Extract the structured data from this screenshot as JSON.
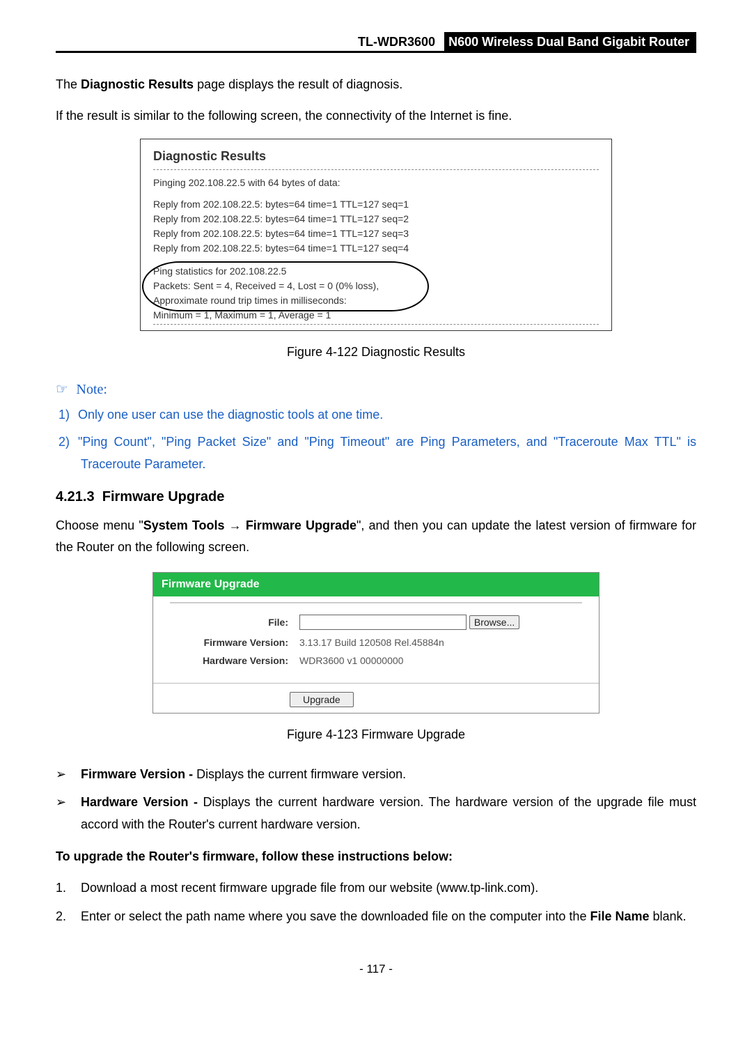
{
  "header": {
    "model": "TL-WDR3600",
    "device": "N600 Wireless Dual Band Gigabit Router"
  },
  "intro": {
    "p1a": "The ",
    "p1b": "Diagnostic Results",
    "p1c": " page displays the result of diagnosis.",
    "p2": "If the result is similar to the following screen, the connectivity of the Internet is fine."
  },
  "diag": {
    "title": "Diagnostic Results",
    "line0": "Pinging 202.108.22.5 with 64 bytes of data:",
    "lines": [
      "Reply from 202.108.22.5:  bytes=64  time=1  TTL=127  seq=1",
      "Reply from 202.108.22.5:  bytes=64  time=1  TTL=127  seq=2",
      "Reply from 202.108.22.5:  bytes=64  time=1  TTL=127  seq=3",
      "Reply from 202.108.22.5:  bytes=64  time=1  TTL=127  seq=4"
    ],
    "stats": [
      "Ping statistics for 202.108.22.5",
      "  Packets: Sent = 4, Received = 4, Lost = 0 (0% loss),",
      "Approximate round trip times in milliseconds:",
      "  Minimum = 1, Maximum = 1, Average = 1"
    ]
  },
  "fig1": "Figure 4-122 Diagnostic Results",
  "note": {
    "icon": "☞",
    "label": "Note:",
    "items": [
      {
        "n": "1)",
        "t": "Only one user can use the diagnostic tools at one time."
      },
      {
        "n": "2)",
        "t": "\"Ping Count\", \"Ping Packet Size\" and \"Ping Timeout\" are Ping Parameters, and \"Traceroute Max TTL\" is Traceroute Parameter."
      }
    ]
  },
  "sect": {
    "num": "4.21.3",
    "title": "Firmware Upgrade",
    "p_a": "Choose menu \"",
    "p_b": "System Tools",
    "arrow": " → ",
    "p_c": "Firmware Upgrade",
    "p_d": "\", and then you can update the latest version of firmware for the Router on the following screen."
  },
  "fw": {
    "header": "Firmware Upgrade",
    "file_label": "File:",
    "browse": "Browse...",
    "ver_label": "Firmware Version:",
    "ver_val": "3.13.17 Build 120508 Rel.45884n",
    "hw_label": "Hardware Version:",
    "hw_val": "WDR3600 v1 00000000",
    "upgrade": "Upgrade"
  },
  "fig2": "Figure 4-123 Firmware Upgrade",
  "bullets": [
    {
      "m": "➢",
      "bold": "Firmware Version -",
      "rest": " Displays the current firmware version."
    },
    {
      "m": "➢",
      "bold": "Hardware Version -",
      "rest": " Displays the current hardware version. The hardware version of the upgrade file must accord with the Router's current hardware version."
    }
  ],
  "instr_head": "To upgrade the Router's firmware, follow these instructions below:",
  "steps": [
    {
      "n": "1.",
      "t": "Download a most recent firmware upgrade file from our website (www.tp-link.com)."
    },
    {
      "n": "2.",
      "t_a": "Enter or select the path name where you save the downloaded file on the computer into the ",
      "t_b": "File Name",
      "t_c": " blank."
    }
  ],
  "pagenum": "- 117 -"
}
